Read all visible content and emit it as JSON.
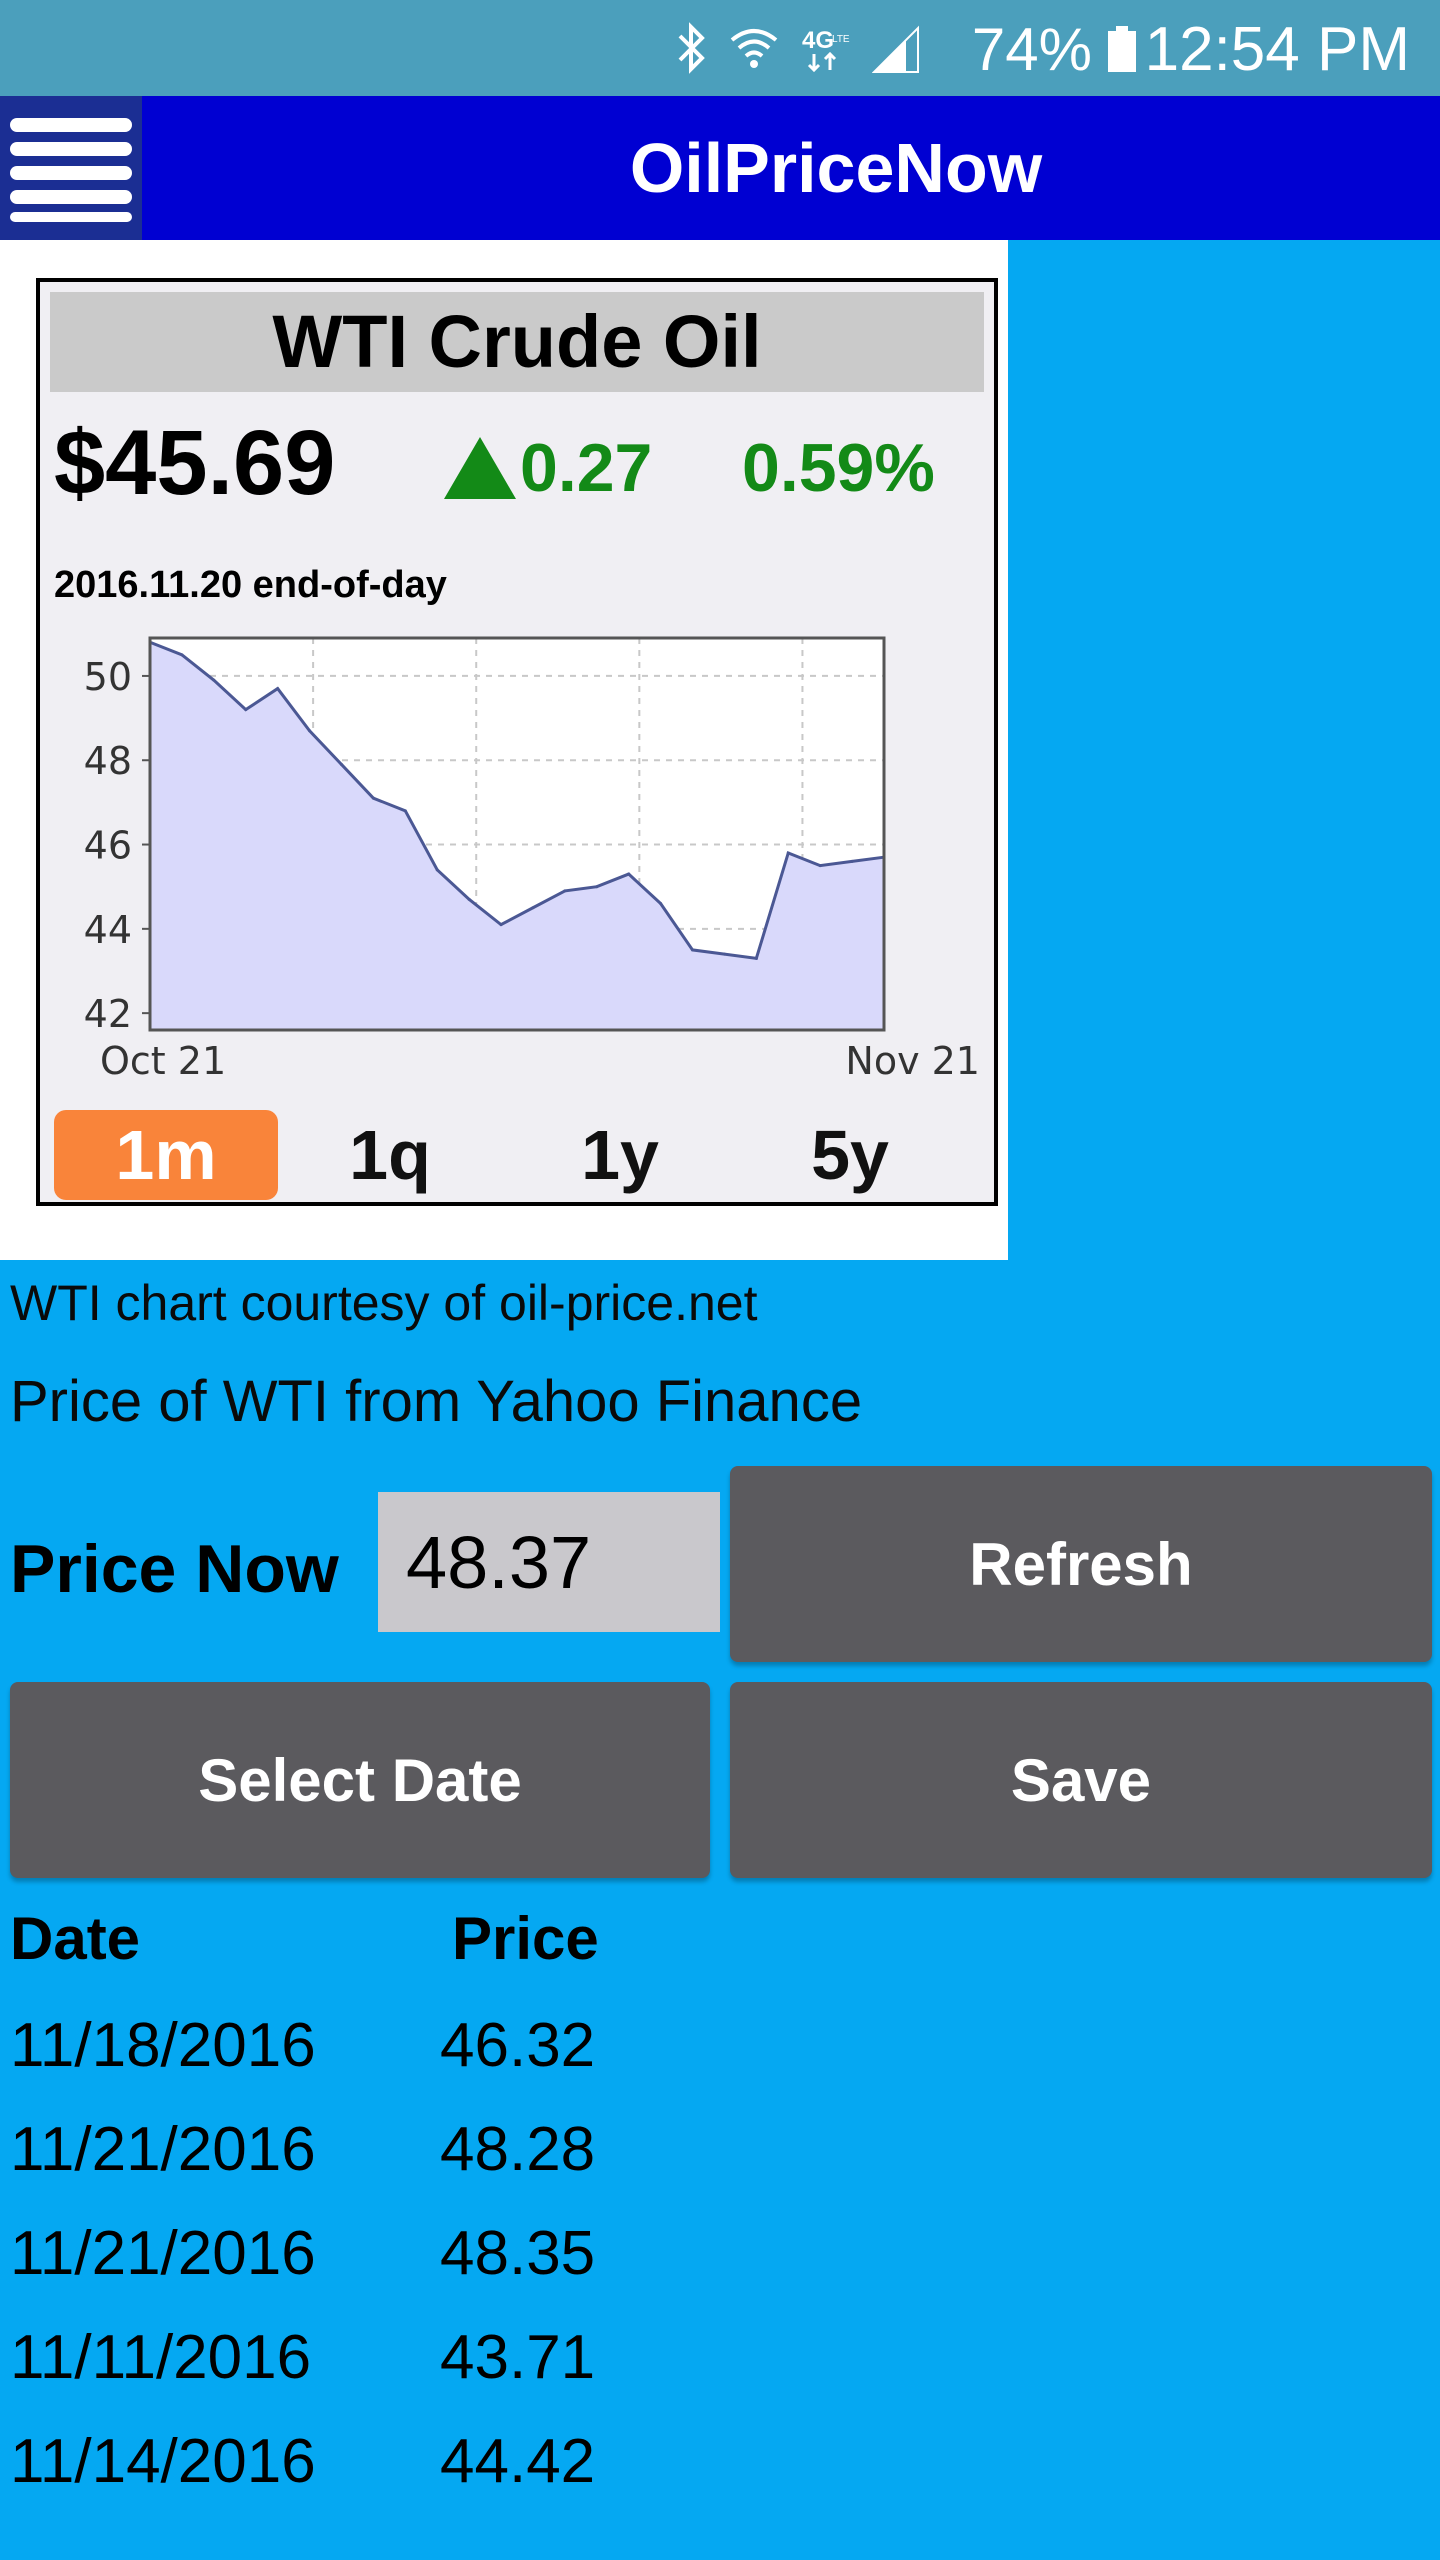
{
  "status_bar": {
    "icons": [
      "bluetooth-icon",
      "wifi-icon",
      "4g-lte-icon",
      "signal-icon"
    ],
    "battery_percent": "74%",
    "time": "12:54 PM",
    "text_color": "#ffffff",
    "background": "#4b9fbc"
  },
  "app_bar": {
    "title": "OilPriceNow",
    "background": "#0000d2"
  },
  "chart_card": {
    "title": "WTI Crude Oil",
    "price": "$45.69",
    "change": "0.27",
    "change_direction": "up",
    "change_percent": "0.59%",
    "as_of": "2016.11.20 end-of-day",
    "up_color": "#138a17",
    "range_tabs": [
      {
        "label": "1m",
        "active": true
      },
      {
        "label": "1q",
        "active": false
      },
      {
        "label": "1y",
        "active": false
      },
      {
        "label": "5y",
        "active": false
      }
    ],
    "active_tab_color": "#f9843a"
  },
  "chart_data": {
    "type": "area",
    "title": "",
    "xlabel": "",
    "ylabel": "",
    "x_tick_labels": [
      "Oct 21",
      "Nov 21"
    ],
    "yticks": [
      42,
      44,
      46,
      48,
      50
    ],
    "ylim": [
      41.6,
      50.9
    ],
    "grid": true,
    "fill_color": "#d9d9fb",
    "line_color": "#4b5894",
    "x": [
      0,
      1,
      2,
      3,
      4,
      5,
      6,
      7,
      8,
      9,
      10,
      11,
      12,
      13,
      14,
      15,
      16,
      17,
      18,
      19,
      20,
      21,
      22,
      23
    ],
    "values": [
      50.8,
      50.5,
      49.9,
      49.2,
      49.7,
      48.7,
      47.9,
      47.1,
      46.8,
      45.4,
      44.7,
      44.1,
      44.5,
      44.9,
      45.0,
      45.3,
      44.6,
      43.5,
      43.4,
      43.3,
      45.8,
      45.5,
      45.6,
      45.7
    ]
  },
  "texts": {
    "courtesy": "WTI chart courtesy of oil-price.net",
    "source": "Price of WTI from Yahoo Finance"
  },
  "price_now": {
    "label": "Price Now",
    "value": "48.37"
  },
  "buttons": {
    "refresh": "Refresh",
    "select_date": "Select Date",
    "save": "Save"
  },
  "history_table": {
    "headers": [
      "Date",
      "Price"
    ],
    "rows": [
      {
        "date": "11/18/2016",
        "price": "46.32"
      },
      {
        "date": "11/21/2016",
        "price": "48.28"
      },
      {
        "date": "11/21/2016",
        "price": "48.35"
      },
      {
        "date": "11/11/2016",
        "price": "43.71"
      },
      {
        "date": "11/14/2016",
        "price": "44.42"
      }
    ]
  }
}
